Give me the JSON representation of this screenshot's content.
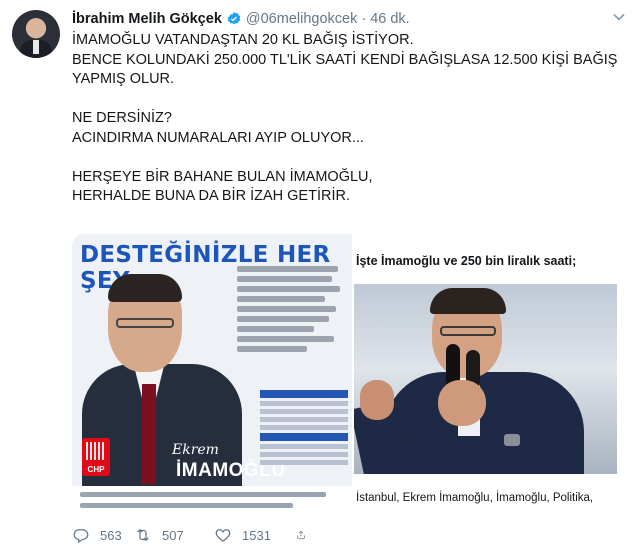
{
  "tweet": {
    "author": {
      "display_name": "İbrahim Melih Gökçek",
      "handle": "@06melihgokcek",
      "separator": "·",
      "time": "46 dk.",
      "verified": true
    },
    "lines": [
      "İMAMOĞLU VATANDAŞTAN 20 KL BAĞIŞ İSTİYOR.",
      "BENCE KOLUNDAKİ 250.000 TL'LİK SAATİ KENDİ BAĞIŞLASA 12.500 KİŞİ BAĞIŞ",
      "YAPMIŞ OLUR.",
      "",
      "NE DERSİNİZ?",
      "ACINDIRMA NUMARALARI AYIP OLUYOR...",
      "",
      "HERŞEYE BİR BAHANE BULAN İMAMOĞLU,",
      "HERHALDE BUNA DA BİR İZAH GETİRİR."
    ],
    "media": {
      "poster": {
        "headline": "DESTEĞİNİZLE HER ŞEY",
        "signature": "Ekrem",
        "name": "İMAMOĞLU",
        "party_logo": "CHP"
      },
      "photo": {
        "caption": "İşte İmamoğlu ve 250 bin liralık saati;",
        "tags": "İstanbul, Ekrem İmamoğlu, İmamoğlu, Politika,"
      }
    },
    "actions": {
      "reply": {
        "icon": "reply-icon",
        "count": "563"
      },
      "retweet": {
        "icon": "retweet-icon",
        "count": "507"
      },
      "like": {
        "icon": "heart-icon",
        "count": "1531"
      },
      "share": {
        "icon": "share-icon"
      }
    }
  },
  "colors": {
    "verified": "#1da1f2",
    "muted": "#657786",
    "text": "#14171a",
    "poster_blue": "#1d56b8",
    "chp_red": "#e30a17"
  }
}
